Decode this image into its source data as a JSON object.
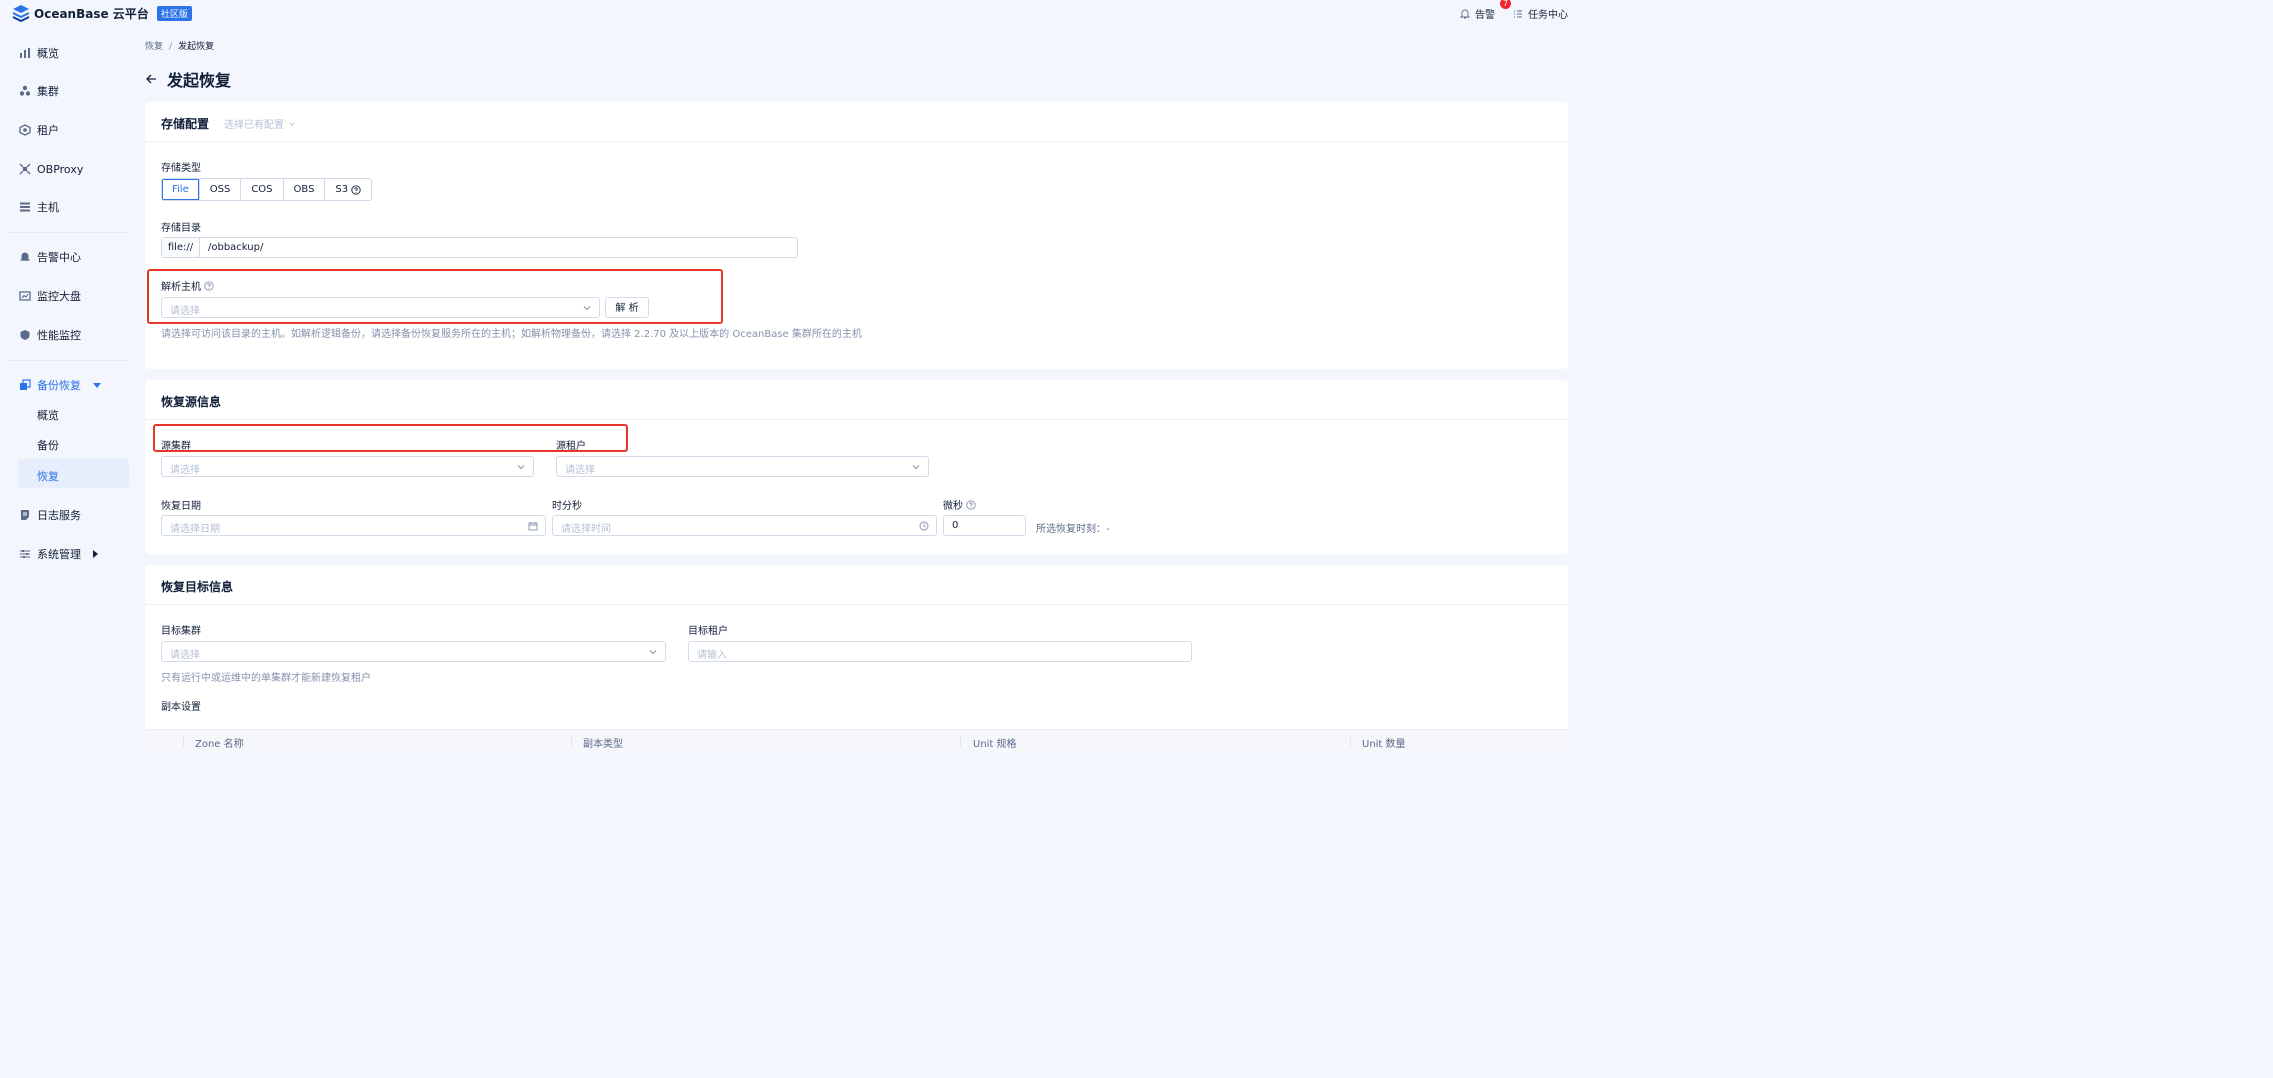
{
  "app": {
    "name": "OceanBase 云平台",
    "edition": "社区版"
  },
  "topbar": {
    "alerts_label": "告警",
    "alerts_count": "7",
    "tasks_label": "任务中心"
  },
  "sidebar": {
    "items": [
      {
        "label": "概览",
        "icon": "bar-chart-icon"
      },
      {
        "label": "集群",
        "icon": "cluster-icon"
      },
      {
        "label": "租户",
        "icon": "tenant-icon"
      },
      {
        "label": "OBProxy",
        "icon": "proxy-icon"
      },
      {
        "label": "主机",
        "icon": "host-icon"
      },
      {
        "label": "告警中心",
        "icon": "bell-icon"
      },
      {
        "label": "监控大盘",
        "icon": "dashboard-icon"
      },
      {
        "label": "性能监控",
        "icon": "shield-icon"
      },
      {
        "label": "备份恢复",
        "icon": "backup-icon"
      },
      {
        "label": "日志服务",
        "icon": "log-icon"
      },
      {
        "label": "系统管理",
        "icon": "settings-icon"
      }
    ],
    "backup_sub": [
      "概览",
      "备份",
      "恢复"
    ]
  },
  "breadcrumb": {
    "parent": "恢复",
    "sep": "/",
    "current": "发起恢复"
  },
  "page": {
    "title": "发起恢复"
  },
  "storage": {
    "title": "存储配置",
    "select_existing": "选择已有配置",
    "type_label": "存储类型",
    "types": [
      "File",
      "OSS",
      "COS",
      "OBS",
      "S3"
    ],
    "selected_type": "File",
    "dir_label": "存储目录",
    "dir_prefix": "file://",
    "dir_value": "/obbackup/",
    "host_label": "解析主机",
    "host_placeholder": "请选择",
    "parse_button": "解 析",
    "host_help": "请选择可访问该目录的主机。如解析逻辑备份，请选择备份恢复服务所在的主机；如解析物理备份，请选择 2.2.70 及以上版本的 OceanBase 集群所在的主机"
  },
  "source": {
    "title": "恢复源信息",
    "cluster_label": "源集群",
    "cluster_placeholder": "请选择",
    "tenant_label": "源租户",
    "tenant_placeholder": "请选择",
    "date_label": "恢复日期",
    "date_placeholder": "请选择日期",
    "time_label": "时分秒",
    "time_placeholder": "请选择时间",
    "micro_label": "微秒",
    "micro_value": "0",
    "selected_time_label": "所选恢复时刻：-"
  },
  "target": {
    "title": "恢复目标信息",
    "cluster_label": "目标集群",
    "cluster_placeholder": "请选择",
    "tenant_label": "目标租户",
    "tenant_placeholder": "请输入",
    "help": "只有运行中或运维中的单集群才能新建恢复租户",
    "replica_label": "副本设置",
    "columns": [
      "Zone 名称",
      "副本类型",
      "Unit 规格",
      "Unit 数量"
    ]
  },
  "colors": {
    "accent": "#2a73e8",
    "highlight": "#e8352a"
  }
}
